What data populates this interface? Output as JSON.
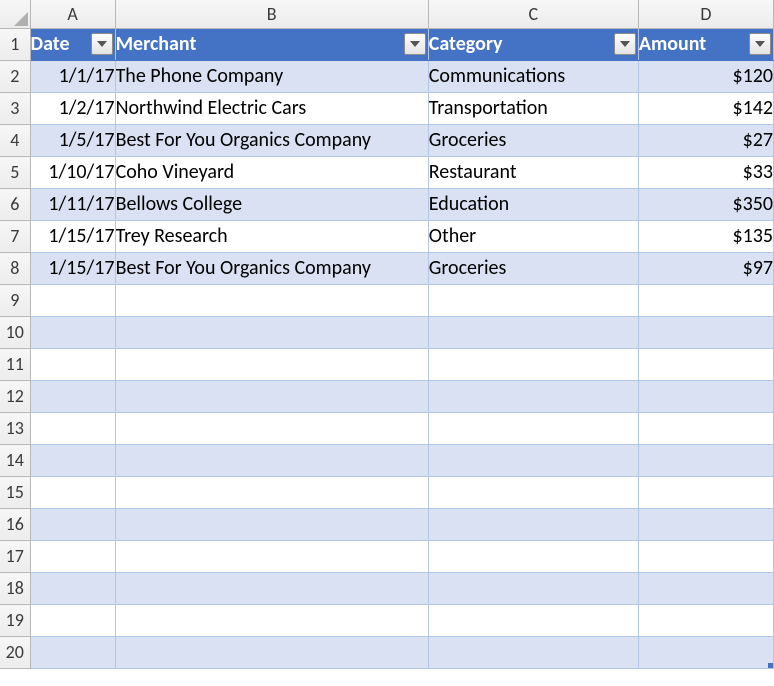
{
  "columns": [
    "A",
    "B",
    "C",
    "D"
  ],
  "rowNumbers": [
    1,
    2,
    3,
    4,
    5,
    6,
    7,
    8,
    9,
    10,
    11,
    12,
    13,
    14,
    15,
    16,
    17,
    18,
    19,
    20
  ],
  "headers": {
    "date": "Date",
    "merchant": "Merchant",
    "category": "Category",
    "amount": "Amount"
  },
  "rows": [
    {
      "date": "1/1/17",
      "merchant": "The Phone Company",
      "category": "Communications",
      "amount": "$120"
    },
    {
      "date": "1/2/17",
      "merchant": "Northwind Electric Cars",
      "category": "Transportation",
      "amount": "$142"
    },
    {
      "date": "1/5/17",
      "merchant": "Best For You Organics Company",
      "category": "Groceries",
      "amount": "$27"
    },
    {
      "date": "1/10/17",
      "merchant": "Coho Vineyard",
      "category": "Restaurant",
      "amount": "$33"
    },
    {
      "date": "1/11/17",
      "merchant": "Bellows College",
      "category": "Education",
      "amount": "$350"
    },
    {
      "date": "1/15/17",
      "merchant": "Trey Research",
      "category": "Other",
      "amount": "$135"
    },
    {
      "date": "1/15/17",
      "merchant": "Best For You Organics Company",
      "category": "Groceries",
      "amount": "$97"
    }
  ],
  "chart_data": {
    "type": "table",
    "columns": [
      "Date",
      "Merchant",
      "Category",
      "Amount"
    ],
    "data": [
      [
        "1/1/17",
        "The Phone Company",
        "Communications",
        120
      ],
      [
        "1/2/17",
        "Northwind Electric Cars",
        "Transportation",
        142
      ],
      [
        "1/5/17",
        "Best For You Organics Company",
        "Groceries",
        27
      ],
      [
        "1/10/17",
        "Coho Vineyard",
        "Restaurant",
        33
      ],
      [
        "1/11/17",
        "Bellows College",
        "Education",
        350
      ],
      [
        "1/15/17",
        "Trey Research",
        "Other",
        135
      ],
      [
        "1/15/17",
        "Best For You Organics Company",
        "Groceries",
        97
      ]
    ]
  }
}
